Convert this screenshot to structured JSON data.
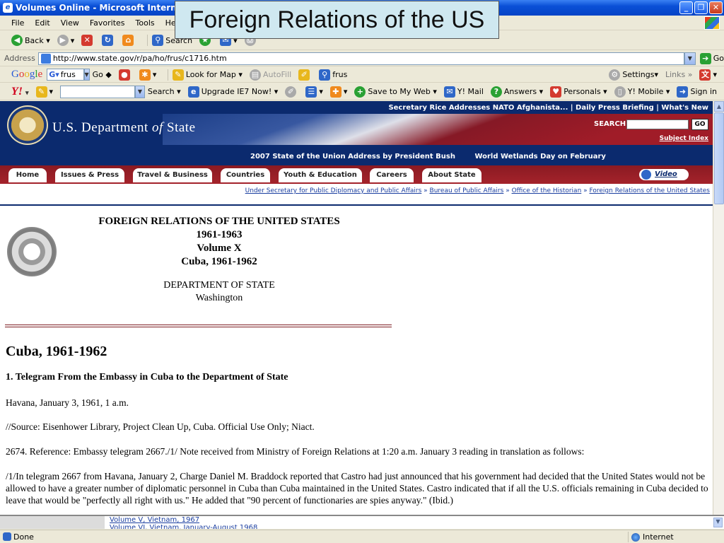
{
  "window": {
    "title": "Volumes Online - Microsoft Internet Explorer",
    "buttons": [
      "_",
      "❐",
      "✕"
    ]
  },
  "overlay_caption": "Foreign Relations of the US",
  "menu": [
    "File",
    "Edit",
    "View",
    "Favorites",
    "Tools",
    "Help"
  ],
  "std_toolbar": {
    "back": "Back",
    "search": "Search"
  },
  "address": {
    "label": "Address",
    "url": "http://www.state.gov/r/pa/ho/frus/c1716.htm",
    "go": "Go"
  },
  "google_bar": {
    "query": "frus",
    "go": "Go",
    "look_for_map": "Look for Map",
    "autofill": "AutoFill",
    "frus": "frus",
    "settings": "Settings",
    "links": "Links"
  },
  "yahoo_bar": {
    "search": "Search",
    "upgrade": "Upgrade IE7 Now!",
    "save": "Save to My Web",
    "mail": "Y! Mail",
    "answers": "Answers",
    "personals": "Personals",
    "mobile": "Y! Mobile",
    "signin": "Sign in"
  },
  "site": {
    "top_links": "Secretary Rice Addresses NATO Afghanista...  |  Daily Press Briefing  |  What's New",
    "dept_name_pre": "U.S. Department ",
    "dept_name_of": "of",
    "dept_name_post": " State",
    "search_label": "SEARCH",
    "go": "GO",
    "subject_index": "Subject Index",
    "news": [
      "2007 State of the Union Address by President Bush",
      "World Wetlands Day on February"
    ],
    "tabs": [
      "Home",
      "Issues & Press",
      "Travel & Business",
      "Countries",
      "Youth & Education",
      "Careers",
      "About State"
    ],
    "video": "Video",
    "breadcrumb": [
      "Under Secretary for Public Diplomacy and Public Affairs",
      "Bureau of Public Affairs",
      "Office of the Historian",
      "Foreign Relations of the United States"
    ]
  },
  "document": {
    "title_lines": [
      "FOREIGN RELATIONS OF THE UNITED STATES",
      "1961-1963",
      "Volume X",
      "Cuba, 1961-1962"
    ],
    "dept_lines": [
      "DEPARTMENT OF STATE",
      "Washington"
    ],
    "heading": "Cuba, 1961-1962",
    "subheading": "1. Telegram From the Embassy in Cuba to the Department of State",
    "paragraphs": [
      "Havana, January 3, 1961, 1 a.m.",
      "//Source: Eisenhower Library, Project Clean Up, Cuba. Official Use Only; Niact.",
      "2674. Reference: Embassy telegram 2667./1/ Note received from Ministry of Foreign Relations at 1:20 a.m. January 3 reading in translation as follows:",
      "/1/In telegram 2667 from Havana, January 2, Charge Daniel M. Braddock reported that Castro had just announced that his government had decided that the United States would not be allowed to have a greater number of diplomatic personnel in Cuba than Cuba maintained in the United States. Castro indicated that if all the U.S. officials remaining in Cuba decided to leave that would be \"perfectly all right with us.\" He added that \"90 percent of functionaries are spies anyway.\" (Ibid.)"
    ]
  },
  "lower_frame": {
    "link1": "Volume V, Vietnam, 1967",
    "link2": "Volume VI, Vietnam, January-August 1968"
  },
  "status": {
    "text": "Done",
    "zone": "Internet"
  }
}
